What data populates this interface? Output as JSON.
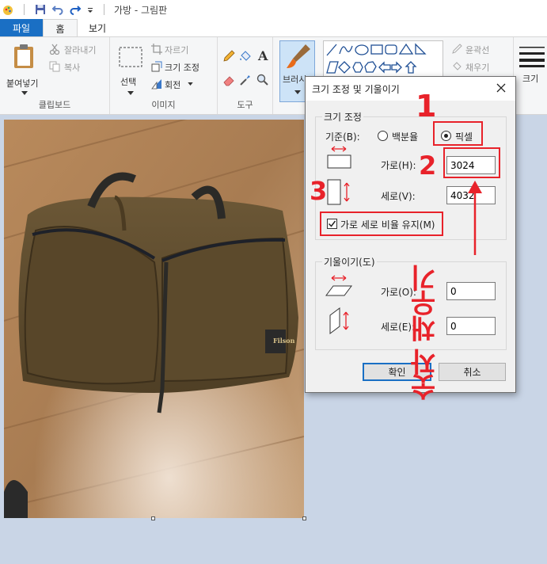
{
  "window": {
    "title": "가방 - 그림판"
  },
  "tabs": {
    "file": "파일",
    "home": "홈",
    "view": "보기"
  },
  "ribbon": {
    "clipboard": {
      "paste": "붙여넣기",
      "cut": "잘라내기",
      "copy": "복사",
      "group": "클립보드"
    },
    "image": {
      "select": "선택",
      "crop": "자르기",
      "resize": "크기 조정",
      "rotate": "회전",
      "group": "이미지"
    },
    "tools": {
      "group": "도구",
      "text_tool": "A"
    },
    "brushes": {
      "label": "브러시"
    },
    "shapes": {
      "outline": "윤곽선",
      "fill": "채우기"
    },
    "size": {
      "label": "크기"
    }
  },
  "dialog": {
    "title": "크기 조정 및 기울이기",
    "resize_section": "크기 조정",
    "by_label": "기준(B):",
    "percent_label": "백분율",
    "pixel_label": "픽셀",
    "selected_mode": "pixel",
    "horizontal_label": "가로(H):",
    "horizontal_value": "3024",
    "vertical_label": "세로(V):",
    "vertical_value": "4032",
    "keep_ratio_label": "가로 세로 비율 유지(M)",
    "keep_ratio_checked": true,
    "skew_section": "기울이기(도)",
    "skew_h_label": "가로(O):",
    "skew_h_value": "0",
    "skew_v_label": "세로(E):",
    "skew_v_value": "0",
    "ok_label": "확인",
    "cancel_label": "취소"
  },
  "annotations": {
    "step1": "1",
    "step2": "2",
    "step3": "3",
    "vertical_note": "숫자 채우기",
    "color": "#e8222a"
  },
  "colors": {
    "accent": "#1a6fc4",
    "canvas_bg": "#c9d5e6"
  }
}
